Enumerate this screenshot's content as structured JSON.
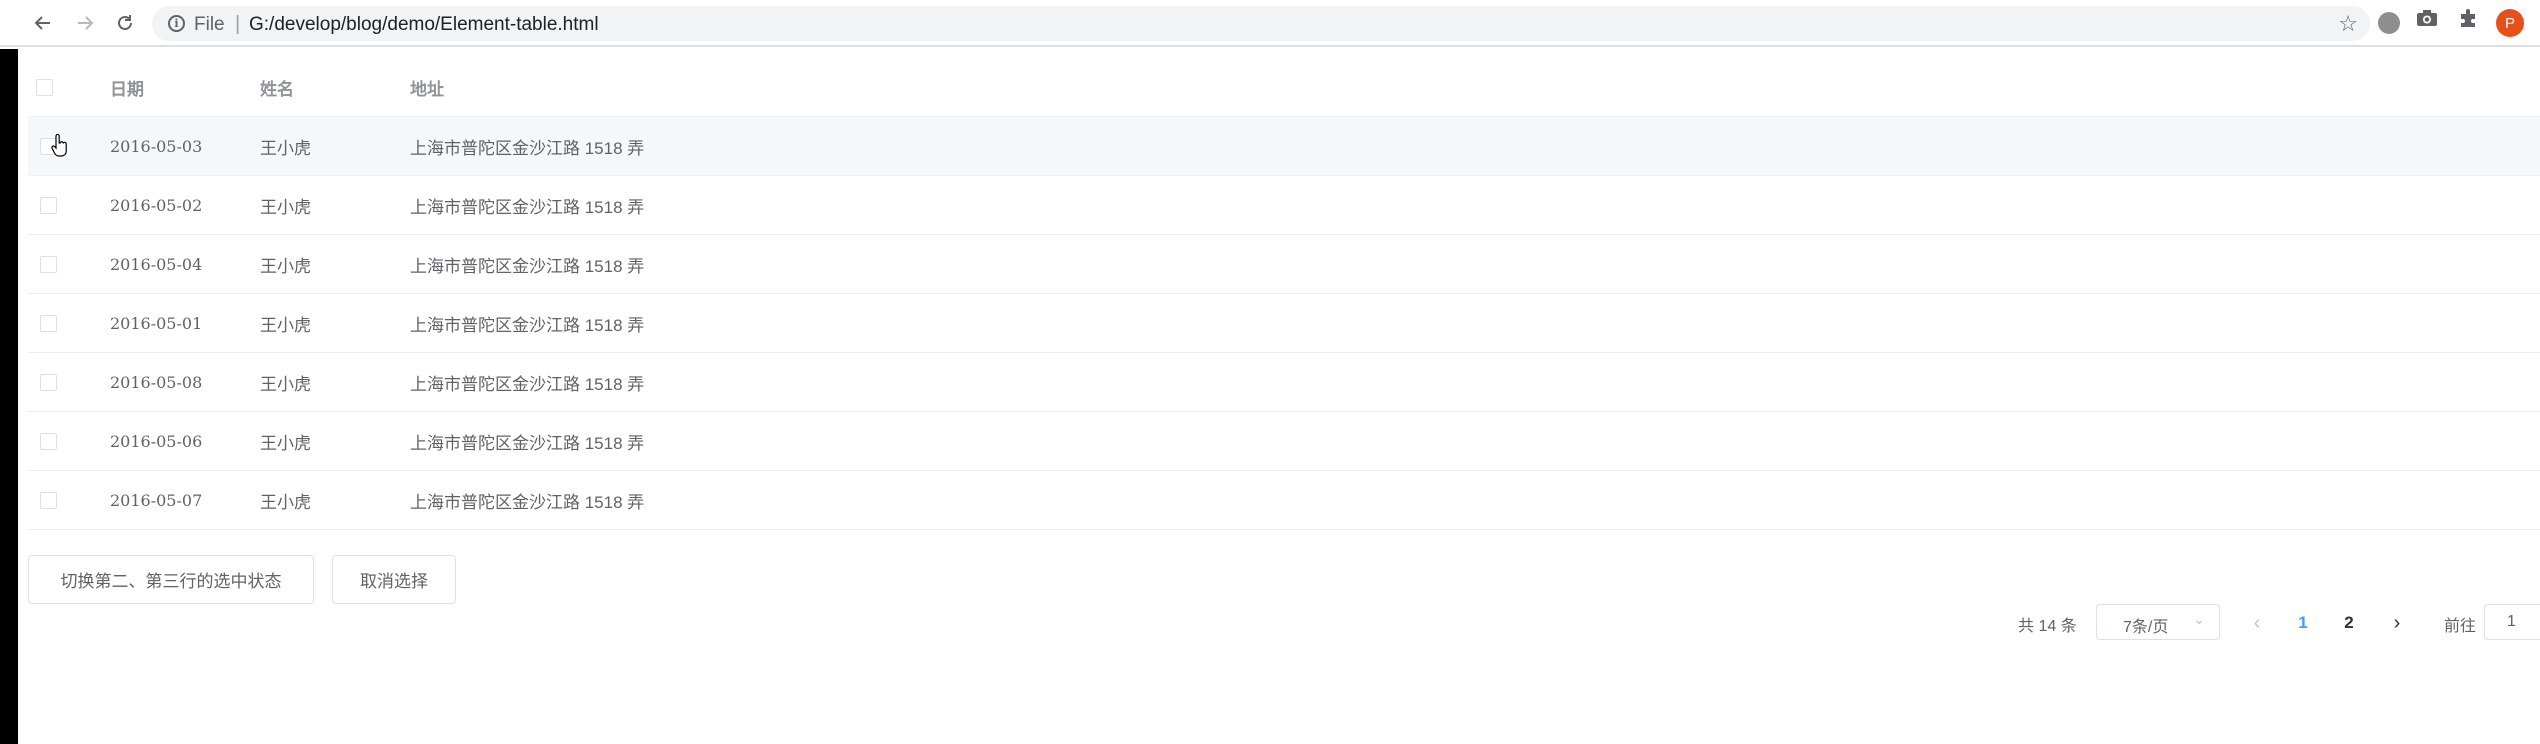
{
  "browser": {
    "scheme_label": "File",
    "separator": "|",
    "url": "G:/develop/blog/demo/Element-table.html",
    "avatar_letter": "P",
    "icons": {
      "back": "arrow-left-icon",
      "forward": "arrow-right-icon",
      "reload": "reload-icon",
      "info": "info-icon",
      "bookmark": "star-icon",
      "extension_1": "circle-icon",
      "extension_2": "camera-icon",
      "extensions": "puzzle-icon"
    }
  },
  "table": {
    "headers": {
      "date": "日期",
      "name": "姓名",
      "address": "地址"
    },
    "rows": [
      {
        "date": "2016-05-03",
        "name": "王小虎",
        "address": "上海市普陀区金沙江路 1518 弄",
        "hovered": true
      },
      {
        "date": "2016-05-02",
        "name": "王小虎",
        "address": "上海市普陀区金沙江路 1518 弄"
      },
      {
        "date": "2016-05-04",
        "name": "王小虎",
        "address": "上海市普陀区金沙江路 1518 弄"
      },
      {
        "date": "2016-05-01",
        "name": "王小虎",
        "address": "上海市普陀区金沙江路 1518 弄"
      },
      {
        "date": "2016-05-08",
        "name": "王小虎",
        "address": "上海市普陀区金沙江路 1518 弄"
      },
      {
        "date": "2016-05-06",
        "name": "王小虎",
        "address": "上海市普陀区金沙江路 1518 弄"
      },
      {
        "date": "2016-05-07",
        "name": "王小虎",
        "address": "上海市普陀区金沙江路 1518 弄"
      }
    ]
  },
  "actions": {
    "toggle_label": "切换第二、第三行的选中状态",
    "clear_label": "取消选择"
  },
  "pagination": {
    "total_text": "共 14 条",
    "page_size": "7条/页",
    "pages": [
      "1",
      "2"
    ],
    "current_page": "1",
    "goto_label": "前往",
    "goto_value": "1"
  },
  "colors": {
    "accent": "#409eff",
    "hover_row": "#f5f7fa",
    "border": "#dcdfe6",
    "avatar": "#e8501a"
  }
}
